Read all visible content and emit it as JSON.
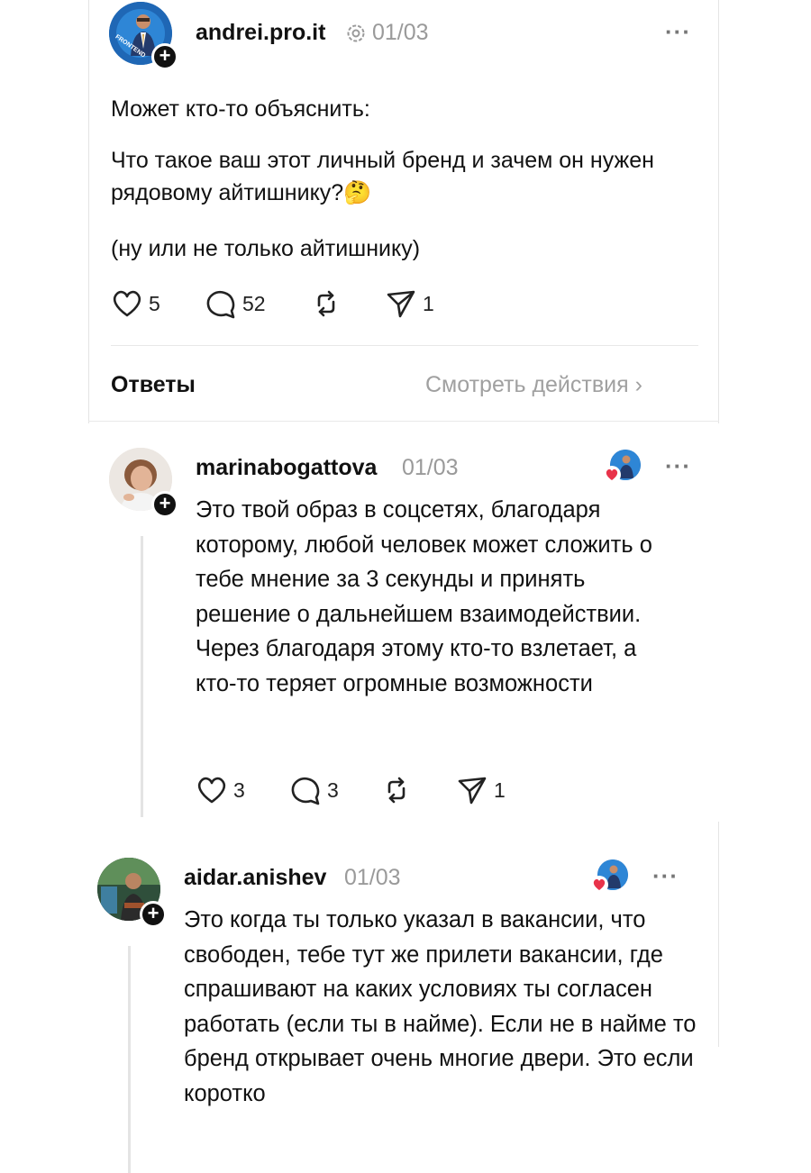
{
  "post": {
    "username": "andrei.pro.it",
    "date": "01/03",
    "avatar_badge": "FRONTEND",
    "paragraphs": [
      "Может кто-то объяснить:",
      "Что такое ваш этот личный бренд и зачем он нужен рядовому айтишнику?🤔",
      "(ну или не только айтишнику)"
    ],
    "likes": "5",
    "comments": "52",
    "shares": "1"
  },
  "replies_header": {
    "label": "Ответы",
    "view_activity": "Смотреть действия ›"
  },
  "replies": [
    {
      "username": "marinabogattova",
      "date": "01/03",
      "text": "Это твой образ в соцсетях, благодаря которому, любой человек может сложить о тебе мнение за 3 секунды и принять решение о дальнейшем взаимодействии. Через благодаря этому кто-то взлетает, а кто-то теряет огромные возможности",
      "likes": "3",
      "comments": "3",
      "shares": "1"
    },
    {
      "username": "aidar.anishev",
      "date": "01/03",
      "text": "Это когда ты только указал в вакансии, что свободен, тебе тут же прилети вакансии, где спрашивают на каких условиях ты согласен работать (если ты в найме). Если не в найме то бренд открывает очень многие двери. Это если коротко"
    }
  ],
  "icons": {
    "like": "heart-outline-icon",
    "comment": "speech-bubble-icon",
    "repost": "repost-icon",
    "share": "send-icon",
    "more": "more-dots-icon",
    "follow": "plus-icon"
  },
  "colors": {
    "text": "#111111",
    "muted": "#9a9a9a",
    "like_badge": "#e8334a"
  }
}
